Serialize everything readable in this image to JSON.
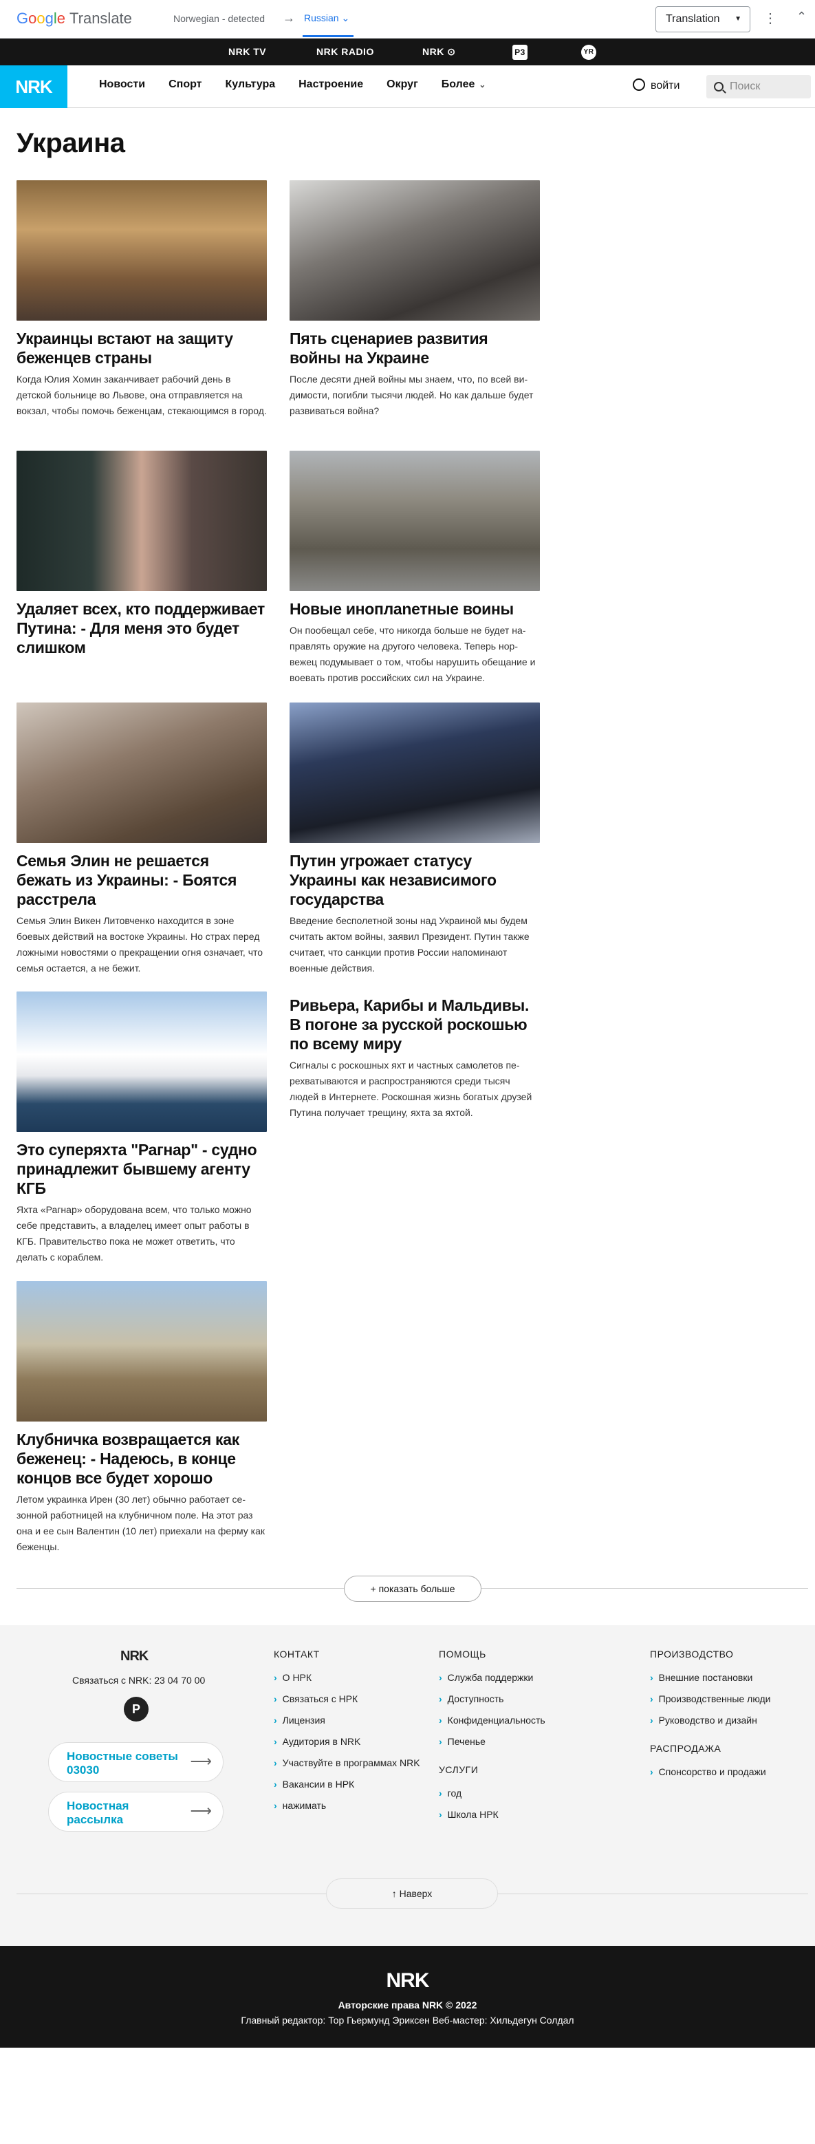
{
  "translate_bar": {
    "logo_google": [
      "G",
      "o",
      "o",
      "g",
      "l",
      "e"
    ],
    "logo_translate": "Translate",
    "source_lang": "Norwegian - detected",
    "arrow": "→",
    "target_lang": "Russian",
    "target_caret": "⌄",
    "mode_button": "Translation",
    "mode_caret": "▼",
    "menu_icon": "⋮",
    "collapse_icon": "⌃"
  },
  "channel_strip": {
    "tv": "NRK TV",
    "radio": "NRK RADIO",
    "super": "NRK ⊙",
    "p3": "P3",
    "yr": "YR"
  },
  "header": {
    "logo": "NRK",
    "nav": [
      "Новости",
      "Спорт",
      "Культура",
      "Настроение",
      "Округ",
      "Более"
    ],
    "more_chevron": "⌄",
    "login": "войти",
    "search_placeholder": "Поиск"
  },
  "page_title": "Украина",
  "articles": [
    {
      "title": "Украинцы встают на защиту беженцев страны",
      "lead": "Когда Юлия Хомин заканчивает рабочий день в детской больнице во Львове, она отправляется на вокзал, чтобы помочь беженцам, стекающимся в город."
    },
    {
      "title": "Пять сценариев развития войны на Украине",
      "lead": "После десяти дней войны мы знаем, что, по всей ви­димости, погибли тысячи людей. Но как дальше бу­дет развиваться война?"
    },
    {
      "title": "Удаляет всех, кто поддерживает Путина: - Для меня это будет слишком",
      "lead": ""
    },
    {
      "title": "Новые иноплanетные воины",
      "lead": "Он пообещал себе, что никогда больше не будет на­правлять оружие на другого человека. Теперь нор­вежец подумывает о том, чтобы нарушить обеща­ние и воевать против российских сил на Украине."
    },
    {
      "title": "Семья Элин не решается бежать из Украины: - Боятся расстрела",
      "lead": "Семья Элин Викен Литовченко находится в зоне боевых действий на востоке Украины. Но страх пе­ред ложными новостями о прекращении огня озна­чает, что семья остается, а не бежит."
    },
    {
      "title": "Путин угрожает статусу Украины как независимого государства",
      "lead": "Введение бесполетной зоны над Украиной мы бу­дем считать актом войны, заявил Президент. Путин также считает, что санкции против России напоми­нают военные действия."
    },
    {
      "title": "Это суперяхта \"Рагнар\" - судно принадлежит бывшему агенту КГБ",
      "lead": "Яхта «Рагнар» оборудована всем, что только мож­но себе представить, а владелец имеет опыт рабо­ты в КГБ. Правительство пока не может ответить, что делать с кораблем."
    },
    {
      "title": "Ривьера, Карибы и Мальдивы. В погоне за русской роскошью по всему миру",
      "lead": "Сигналы с роскошных яхт и частных самолетов пе­рехватываются и распространяются среди тысяч людей в Интернете. Роскошная жизнь богатых дру­зей Путина получает трещину, яхта за яхтой."
    },
    {
      "title": "Клубничка возвращается как беженец: - Надеюсь, в конце концов все будет хорошо",
      "lead": "Летом украинка Ирен (30 лет) обычно работает се­зонной работницей на клубничном поле. На этот раз она и ее сын Валентин (10 лет) приехали на ферму как беженцы."
    }
  ],
  "show_more": "+ показать больше",
  "footer": {
    "logo": "NRK",
    "phone": "Связаться с NRK: 23 04 70 00",
    "p_icon": "P",
    "tips": "Новостные советы 03030",
    "newsletter": "Новостная рассылка",
    "pill_arrow": "⟶",
    "chevron": "›",
    "contact_title": "КОНТАКТ",
    "contact": [
      "О НРК",
      "Связаться с НРК",
      "Лицензия",
      "Аудитория в NRK",
      "Участвуйте в программах NRK",
      "Вакансии в НРК",
      "нажимать"
    ],
    "help_title": "ПОМОЩЬ",
    "help": [
      "Служба поддержки",
      "Доступность",
      "Конфиденциальность",
      "Печенье"
    ],
    "services_title": "УСЛУГИ",
    "services": [
      "год",
      "Школа НРК"
    ],
    "production_title": "ПРОИЗВОДСТВО",
    "production": [
      "Внешние постановки",
      "Производственные люди",
      "Руководство и дизайн"
    ],
    "sales_title": "РАСПРОДАЖА",
    "sales": [
      "Спонсорство и продажи"
    ],
    "to_top": "↑ Наверх"
  },
  "bottom": {
    "logo": "NRK",
    "copyright": "Авторские права NRK © 2022",
    "editors": "Главный редактор: Тор Гьермунд Эриксен   Веб-мастер: Хильдегун Солдал"
  },
  "colors": {
    "nrk_blue": "#00b9f2",
    "link_teal": "#00a1c9",
    "gt_blue": "#1a73e8",
    "strip_dark": "#151515"
  }
}
